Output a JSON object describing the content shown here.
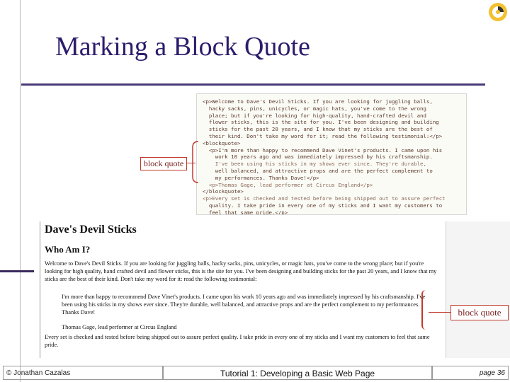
{
  "slide": {
    "title": "Marking a Block Quote"
  },
  "code": {
    "lines": [
      "<p>Welcome to Dave's Devil Sticks. If you are looking for juggling balls,",
      "  hacky sacks, pins, unicycles, or magic hats, you've come to the wrong",
      "  place; but if you're looking for high-quality, hand-crafted devil and",
      "  flower sticks, this is the site for you. I've been designing and building",
      "  sticks for the past 20 years, and I know that my sticks are the best of",
      "  their kind. Don't take my word for it; read the following testimonial:</p>",
      "<blockquote>",
      "  <p>I'm more than happy to recommend Dave Vinet's products. I came upon his",
      "    work 10 years ago and was immediately impressed by his craftsmanship.",
      "    I've been using his sticks in my shows ever since. They're durable,",
      "    well balanced, and attractive props and are the perfect complement to",
      "    my performances. Thanks Dave!</p>",
      "",
      "  <p>Thomas Gage, lead performer at Circus England</p>",
      "</blockquote>",
      "<p>Every set is checked and tested before being shipped out to assure perfect",
      "  quality. I take pride in every one of my sticks and I want my customers to",
      "  feel that same pride.</p>"
    ],
    "callout": "block quote"
  },
  "page": {
    "title": "Dave's Devil Sticks",
    "heading": "Who Am I?",
    "para1": "Welcome to Dave's Devil Sticks. If you are looking for juggling balls, hacky sacks, pins, unicycles, or magic hats, you've come to the wrong place; but if you're looking for high quality, hand crafted devil and flower sticks, this is the site for you. I've been designing and building sticks for the past 20 years, and I know that my sticks are the best of their kind. Don't take my word for it: read the following testimonial:",
    "quote1": "I'm more than happy to recommend Dave Vinet's products. I came upon his work 10 years ago and was immediately impressed by his craftsmanship. I've been using his sticks in my shows ever since. They're durable, well balanced, and attractive props and are the perfect complement to my performances. Thanks Dave!",
    "quote2": "Thomas Gage, lead performer at Circus England",
    "para2": "Every set is checked and tested before being shipped out to assure perfect quality. I take pride in every one of my sticks and I want my customers to feel that same pride.",
    "callout": "block quote"
  },
  "footer": {
    "author": "© Jonathan Cazalas",
    "course": "Tutorial 1: Developing a Basic Web Page",
    "page": "page 36"
  }
}
